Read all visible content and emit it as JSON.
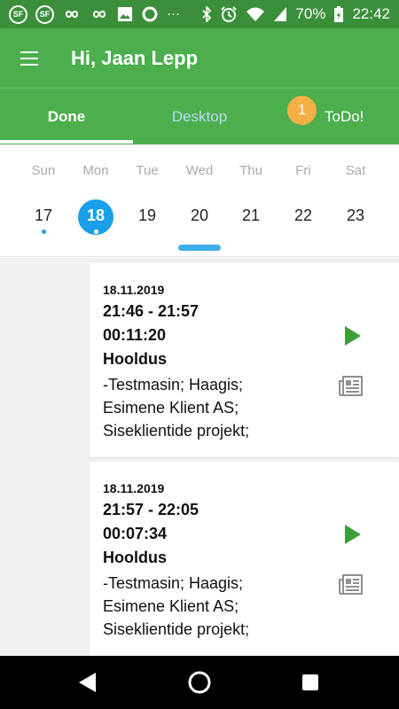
{
  "status_bar": {
    "app_icons": [
      "SF",
      "SF"
    ],
    "battery": "70%",
    "time": "22:42"
  },
  "app_bar": {
    "title": "Hi, Jaan Lepp"
  },
  "tabs": {
    "done": "Done",
    "desktop": "Desktop",
    "todo": "ToDo!",
    "todo_badge": "1"
  },
  "week": [
    {
      "name": "Sun",
      "num": "17",
      "dot": true,
      "selected": false
    },
    {
      "name": "Mon",
      "num": "18",
      "dot": true,
      "selected": true
    },
    {
      "name": "Tue",
      "num": "19",
      "dot": false,
      "selected": false
    },
    {
      "name": "Wed",
      "num": "20",
      "dot": false,
      "selected": false
    },
    {
      "name": "Thu",
      "num": "21",
      "dot": false,
      "selected": false
    },
    {
      "name": "Fri",
      "num": "22",
      "dot": false,
      "selected": false
    },
    {
      "name": "Sat",
      "num": "23",
      "dot": false,
      "selected": false
    }
  ],
  "entries": [
    {
      "date": "18.11.2019",
      "time": "21:46 - 21:57",
      "duration": "00:11:20",
      "type": "Hooldus",
      "lines": [
        "-Testmasin; Haagis;",
        "Esimene Klient AS;",
        "Siseklientide projekt;"
      ]
    },
    {
      "date": "18.11.2019",
      "time": "21:57 - 22:05",
      "duration": "00:07:34",
      "type": "Hooldus",
      "lines": [
        "-Testmasin; Haagis;",
        "Esimene Klient AS;",
        "Siseklientide projekt;"
      ]
    }
  ],
  "colors": {
    "status_bar": "#3b8f3b",
    "app_bar": "#4cae4c",
    "selected_day": "#1aa0e8",
    "badge": "#f5b045",
    "play": "#3ba03b"
  },
  "icons": {
    "menu": "hamburger-menu-icon",
    "play": "play-icon",
    "details": "newspaper-icon",
    "back": "back-triangle-icon",
    "home": "home-circle-icon",
    "recents": "recents-square-icon"
  }
}
